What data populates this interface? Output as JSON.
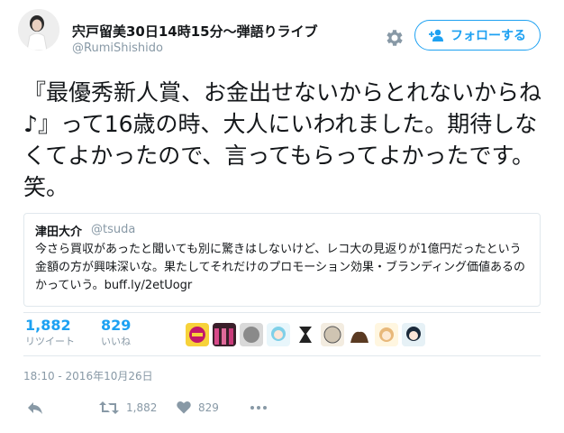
{
  "user": {
    "display_name": "宍戸留美30日14時15分～弾語りライブ",
    "handle": "@RumiShishido"
  },
  "follow_button": {
    "label": "フォローする"
  },
  "tweet": {
    "text": "『最優秀新人賞、お金出せないからとれないからね♪』って16歳の時、大人にいわれました。期待しなくてよかったので、言ってもらってよかったです。笑。"
  },
  "quoted_tweet": {
    "name": "津田大介",
    "handle": "@tsuda",
    "text": "今さら買収があったと聞いても別に驚きはしないけど、レコ大の見返りが1億円だったという金額の方が興味深いな。果たしてそれだけのプロモーション効果・ブランディング価値あるのかっていう。buff.ly/2etUogr"
  },
  "stats": {
    "retweets": {
      "count": "1,882",
      "label": "リツイート"
    },
    "likes": {
      "count": "829",
      "label": "いいね"
    }
  },
  "liker_avatars": [
    "avatar-1",
    "avatar-2",
    "avatar-3",
    "avatar-4",
    "avatar-5",
    "avatar-6",
    "avatar-7",
    "avatar-8",
    "avatar-9"
  ],
  "timestamp": "18:10 - 2016年10月26日",
  "actions": {
    "retweet_count": "1,882",
    "like_count": "829"
  },
  "colors": {
    "accent": "#1da1f2",
    "muted": "#8899a6",
    "border": "#e1e8ed"
  },
  "icons": [
    "gear-icon",
    "follow-user-icon",
    "reply-icon",
    "retweet-icon",
    "heart-icon",
    "more-icon"
  ]
}
